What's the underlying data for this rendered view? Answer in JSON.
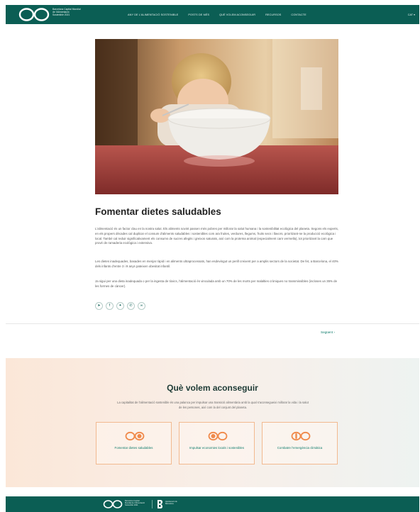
{
  "header": {
    "logo_text": "Barcelona Capital Mundial de l'Alimentació Sostenible 2021",
    "nav": [
      "ANY DE L'ALIMENTACIÓ SOSTENIBLE",
      "POSTS DE MÉS",
      "QUÈ VOLEM ACONSEGUIR",
      "RECURSOS",
      "CONTACTE"
    ],
    "lang": "CAT ▾"
  },
  "article": {
    "title": "Fomentar dietes saludables",
    "paragraphs": [
      "L'alimentació és un factor clau en la nostra salut. Els aliments sovint passen més pobres per millorar la salut humana i la sostenibilitat ecològica del planeta. Segons els experts, en els propers dècades cal duplicar el consum d'aliments saludables i sostenibles com ara fruites, verdures, llegums, fruits secs i llavors, prioritzant-ne la producció ecològica i local. També cal reduir significativament els consums de sucres afegits i greixos saturats, així com la proteïna animal (especialment carn vermella), tot prioritzant la carn que prové de ramaderia ecològica i extensiva.",
      "Les dietes inadequades, basades en menjar ràpid i en aliments ultraprocessats, han esdevingut un perill creixent per a amplis sectors de la societat. De fet, a Barcelona, el 40% dels infants d'entre 3 i 9 anys pateixen obesitat infantil.",
      "Ja sigui per una dieta inadequada o per la ingesta de tòxics, l'alimentació és vinculada amb un 70% de les morts per malalties cròniques no transmissibles (incloses un 35% de les formes de càncer)."
    ],
    "share_icons": [
      "telegram-icon",
      "facebook-icon",
      "twitter-icon",
      "whatsapp-icon",
      "link-icon"
    ],
    "next_label": "Següent ›"
  },
  "aims": {
    "title": "Què volem aconseguir",
    "subtitle": "La capitalitat de l'alimentació sostenible és una palanca per impulsar una transició alimentària amb la qual s'aconsegueixi millorar la vida i la salut de les persones, així com la del conjunt del planeta.",
    "cards": [
      {
        "label": "Fomentar dietes saludables",
        "icon": "healthy-diet-icon"
      },
      {
        "label": "Impulsar economies locals i sostenibles",
        "icon": "local-economy-icon"
      },
      {
        "label": "Combatre l'emergència climàtica",
        "icon": "climate-icon"
      }
    ]
  },
  "footer": {
    "logo_text": "Barcelona Capital Mundial de l'Alimentació Sostenible 2021",
    "partner_text": "Ajuntament de Barcelona"
  },
  "colors": {
    "brand": "#0b5e54",
    "accent": "#f2b98f",
    "link": "#0b7a6a"
  }
}
